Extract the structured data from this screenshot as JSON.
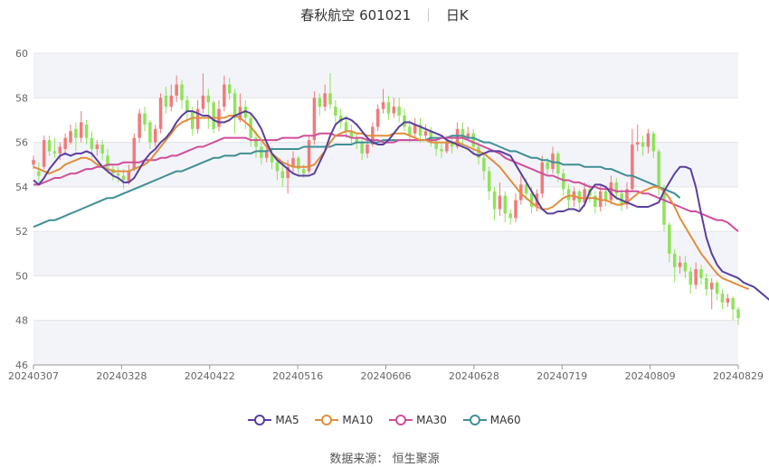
{
  "header": {
    "stock_name": "春秋航空",
    "stock_code": "601021",
    "period": "日K"
  },
  "source": {
    "label": "数据来源：",
    "provider": "恒生聚源"
  },
  "colors": {
    "up": "#f07b7b",
    "down": "#8fe35a",
    "ma5": "#5a3f9e",
    "ma10": "#e08e3c",
    "ma30": "#d04e9b",
    "ma60": "#3f8f96",
    "band": "#f3f4f9",
    "grid": "#e3e3e3"
  },
  "chart_data": {
    "type": "candlestick",
    "title": "春秋航空 601021 日K",
    "y_range": [
      46,
      60
    ],
    "y_ticks": [
      46,
      48,
      50,
      52,
      54,
      56,
      58,
      60
    ],
    "x_tick_labels": [
      "20240307",
      "20240328",
      "20240422",
      "20240516",
      "20240606",
      "20240628",
      "20240719",
      "20240809",
      "20240829"
    ],
    "legend": [
      "MA5",
      "MA10",
      "MA30",
      "MA60"
    ],
    "candles": [
      [
        55.0,
        55.2,
        55.4,
        54.8
      ],
      [
        54.7,
        54.5,
        55.1,
        54.2
      ],
      [
        54.9,
        56.1,
        56.3,
        54.8
      ],
      [
        56.1,
        55.6,
        56.3,
        55.4
      ],
      [
        55.6,
        55.5,
        56.2,
        55.3
      ],
      [
        55.5,
        55.8,
        56.0,
        55.2
      ],
      [
        55.7,
        56.2,
        56.4,
        55.5
      ],
      [
        56.0,
        56.5,
        56.8,
        55.9
      ],
      [
        56.6,
        56.2,
        56.9,
        55.6
      ],
      [
        56.2,
        56.9,
        57.4,
        56.0
      ],
      [
        56.8,
        56.2,
        57.0,
        55.9
      ],
      [
        56.2,
        55.7,
        56.5,
        55.3
      ],
      [
        55.7,
        55.9,
        56.1,
        55.4
      ],
      [
        55.9,
        55.5,
        56.1,
        55.2
      ],
      [
        55.4,
        54.9,
        55.7,
        54.6
      ],
      [
        54.8,
        54.6,
        55.0,
        54.3
      ],
      [
        54.6,
        54.5,
        54.9,
        54.2
      ],
      [
        54.5,
        54.3,
        54.8,
        53.9
      ],
      [
        54.2,
        54.7,
        55.0,
        54.1
      ],
      [
        54.8,
        56.2,
        56.4,
        54.7
      ],
      [
        56.2,
        57.3,
        57.5,
        56.0
      ],
      [
        57.3,
        56.8,
        57.6,
        56.5
      ],
      [
        56.9,
        56.0,
        57.0,
        55.7
      ],
      [
        56.0,
        56.6,
        56.8,
        55.8
      ],
      [
        56.6,
        58.0,
        58.2,
        56.4
      ],
      [
        58.1,
        57.6,
        58.5,
        57.3
      ],
      [
        57.6,
        58.1,
        58.6,
        57.4
      ],
      [
        58.1,
        58.6,
        59.0,
        57.8
      ],
      [
        58.6,
        57.9,
        58.8,
        57.5
      ],
      [
        57.9,
        57.4,
        58.1,
        56.9
      ],
      [
        57.4,
        56.6,
        57.6,
        56.3
      ],
      [
        56.6,
        57.5,
        57.9,
        56.4
      ],
      [
        57.5,
        58.1,
        59.1,
        57.3
      ],
      [
        58.1,
        57.8,
        58.4,
        56.6
      ],
      [
        57.8,
        56.6,
        57.9,
        56.4
      ],
      [
        56.7,
        57.5,
        57.9,
        56.5
      ],
      [
        57.6,
        58.6,
        59.0,
        57.4
      ],
      [
        58.6,
        58.2,
        58.9,
        57.9
      ],
      [
        58.2,
        57.1,
        58.4,
        56.4
      ],
      [
        57.0,
        57.6,
        58.2,
        56.9
      ],
      [
        57.6,
        57.1,
        57.9,
        56.6
      ],
      [
        57.1,
        56.2,
        57.3,
        55.8
      ],
      [
        56.2,
        55.8,
        56.5,
        55.3
      ],
      [
        55.8,
        55.3,
        56.0,
        55.0
      ],
      [
        55.3,
        55.6,
        55.9,
        55.1
      ],
      [
        55.5,
        55.1,
        55.8,
        54.8
      ],
      [
        55.1,
        54.7,
        55.3,
        54.3
      ],
      [
        54.7,
        54.4,
        55.0,
        54.0
      ],
      [
        54.4,
        54.9,
        55.2,
        53.7
      ],
      [
        54.9,
        55.3,
        55.6,
        54.6
      ],
      [
        55.3,
        54.8,
        55.4,
        54.5
      ],
      [
        54.8,
        54.6,
        55.0,
        54.4
      ],
      [
        54.7,
        56.1,
        56.3,
        54.6
      ],
      [
        56.1,
        58.0,
        58.3,
        55.9
      ],
      [
        58.0,
        57.6,
        58.2,
        57.2
      ],
      [
        57.6,
        58.2,
        58.6,
        57.4
      ],
      [
        58.2,
        57.7,
        59.1,
        57.5
      ],
      [
        57.6,
        57.2,
        57.9,
        56.8
      ],
      [
        57.2,
        56.9,
        57.5,
        56.6
      ],
      [
        56.9,
        56.5,
        57.2,
        56.2
      ],
      [
        56.5,
        56.2,
        56.8,
        55.9
      ],
      [
        56.2,
        56.0,
        56.4,
        55.7
      ],
      [
        56.0,
        55.5,
        56.2,
        55.2
      ],
      [
        55.5,
        55.9,
        56.1,
        55.3
      ],
      [
        55.9,
        56.7,
        56.9,
        55.8
      ],
      [
        56.7,
        57.5,
        57.7,
        56.5
      ],
      [
        57.5,
        57.8,
        58.4,
        57.3
      ],
      [
        57.8,
        57.3,
        58.1,
        57.0
      ],
      [
        57.3,
        57.6,
        58.0,
        57.1
      ],
      [
        57.6,
        57.2,
        58.0,
        56.9
      ],
      [
        57.2,
        56.7,
        57.5,
        56.5
      ],
      [
        56.7,
        56.3,
        57.0,
        56.0
      ],
      [
        56.4,
        56.8,
        57.1,
        56.2
      ],
      [
        56.8,
        56.3,
        57.1,
        56.0
      ],
      [
        56.3,
        56.5,
        56.8,
        56.1
      ],
      [
        56.5,
        56.0,
        56.7,
        55.8
      ],
      [
        56.0,
        55.7,
        56.2,
        55.4
      ],
      [
        55.7,
        55.6,
        56.0,
        55.3
      ],
      [
        55.6,
        56.0,
        56.3,
        55.5
      ],
      [
        56.0,
        55.8,
        56.3,
        55.5
      ],
      [
        55.8,
        56.6,
        56.9,
        55.7
      ],
      [
        56.6,
        56.2,
        56.9,
        55.9
      ],
      [
        56.2,
        56.4,
        56.7,
        56.1
      ],
      [
        56.4,
        55.8,
        56.6,
        55.5
      ],
      [
        55.8,
        55.3,
        56.0,
        55.0
      ],
      [
        55.3,
        54.7,
        55.5,
        54.3
      ],
      [
        54.7,
        53.8,
        54.9,
        53.4
      ],
      [
        53.8,
        53.0,
        54.0,
        52.5
      ],
      [
        53.0,
        53.6,
        54.2,
        52.7
      ],
      [
        53.6,
        52.8,
        53.8,
        52.4
      ],
      [
        52.8,
        52.6,
        53.0,
        52.3
      ],
      [
        52.6,
        53.4,
        53.7,
        52.4
      ],
      [
        53.4,
        54.1,
        54.5,
        53.2
      ],
      [
        54.1,
        53.7,
        54.4,
        53.4
      ],
      [
        53.7,
        53.1,
        54.0,
        52.8
      ],
      [
        53.1,
        53.7,
        53.9,
        52.9
      ],
      [
        53.7,
        55.1,
        55.4,
        53.5
      ],
      [
        55.1,
        54.8,
        55.3,
        54.5
      ],
      [
        54.8,
        55.5,
        55.8,
        54.6
      ],
      [
        55.5,
        54.6,
        55.6,
        54.2
      ],
      [
        54.6,
        53.9,
        54.8,
        53.6
      ],
      [
        53.9,
        53.4,
        54.1,
        53.0
      ],
      [
        53.4,
        53.8,
        54.0,
        53.1
      ],
      [
        53.8,
        53.3,
        53.9,
        53.0
      ],
      [
        53.3,
        53.9,
        54.2,
        53.1
      ],
      [
        53.9,
        53.6,
        54.1,
        53.3
      ],
      [
        53.6,
        53.1,
        53.8,
        52.8
      ],
      [
        53.1,
        53.8,
        54.1,
        52.9
      ],
      [
        53.8,
        53.4,
        54.0,
        53.1
      ],
      [
        53.4,
        54.2,
        54.5,
        53.2
      ],
      [
        54.2,
        53.7,
        54.4,
        53.4
      ],
      [
        53.7,
        53.2,
        53.9,
        52.9
      ],
      [
        53.2,
        53.9,
        54.2,
        53.0
      ],
      [
        53.9,
        55.9,
        56.6,
        53.8
      ],
      [
        55.9,
        56.0,
        56.8,
        55.6
      ],
      [
        56.0,
        55.8,
        56.3,
        55.4
      ],
      [
        55.8,
        56.4,
        56.6,
        55.5
      ],
      [
        56.4,
        55.6,
        56.5,
        55.3
      ],
      [
        55.6,
        53.9,
        55.7,
        53.6
      ],
      [
        53.9,
        52.3,
        54.1,
        52.0
      ],
      [
        52.3,
        51.0,
        52.4,
        50.6
      ],
      [
        51.0,
        50.4,
        51.2,
        49.7
      ],
      [
        50.4,
        50.6,
        50.9,
        50.1
      ],
      [
        50.6,
        50.2,
        50.9,
        49.9
      ],
      [
        50.2,
        49.6,
        50.4,
        49.2
      ],
      [
        49.6,
        50.3,
        50.6,
        49.4
      ],
      [
        50.3,
        49.9,
        50.5,
        49.6
      ],
      [
        49.9,
        49.4,
        50.1,
        49.1
      ],
      [
        49.4,
        49.7,
        49.9,
        48.5
      ],
      [
        49.7,
        49.2,
        49.8,
        48.9
      ],
      [
        49.2,
        48.8,
        49.4,
        48.5
      ],
      [
        48.8,
        49.0,
        49.2,
        48.6
      ],
      [
        49.0,
        48.5,
        49.1,
        48.0
      ],
      [
        48.5,
        48.1,
        48.6,
        47.8
      ]
    ],
    "ma5": [
      54.3,
      54.1,
      54.4,
      54.8,
      55.1,
      55.4,
      55.5,
      55.4,
      55.5,
      55.5,
      55.6,
      55.5,
      55.2,
      54.9,
      54.7,
      54.5,
      54.4,
      54.2,
      54.2,
      54.4,
      54.8,
      55.2,
      55.5,
      55.7,
      56.0,
      56.2,
      56.5,
      56.9,
      57.2,
      57.4,
      57.4,
      57.3,
      57.2,
      57.2,
      57.0,
      56.9,
      56.9,
      57.0,
      57.2,
      57.3,
      57.4,
      57.3,
      57.0,
      56.6,
      56.0,
      55.5,
      55.2,
      55.0,
      54.8,
      54.6,
      54.5,
      54.5,
      54.5,
      54.6,
      55.1,
      55.6,
      56.3,
      56.8,
      57.0,
      57.1,
      57.0,
      56.8,
      56.5,
      56.2,
      56.0,
      55.9,
      55.9,
      56.1,
      56.4,
      56.7,
      56.9,
      56.9,
      56.8,
      56.7,
      56.6,
      56.5,
      56.4,
      56.3,
      56.1,
      56.0,
      55.9,
      55.8,
      55.7,
      55.5,
      55.4,
      55.5,
      55.6,
      55.6,
      55.6,
      55.5,
      55.4,
      55.0,
      54.6,
      54.2,
      53.8,
      53.4,
      53.0,
      52.8,
      52.8,
      52.9,
      52.9,
      53.0,
      53.0,
      52.9,
      53.2,
      53.8,
      54.1,
      54.1,
      54.0,
      53.7,
      53.5,
      53.4,
      53.3,
      53.2,
      53.1,
      53.1,
      53.1,
      53.2,
      53.3,
      53.8,
      54.2,
      54.6,
      54.9,
      54.9,
      54.8,
      54.0,
      52.8,
      51.7,
      51.0,
      50.5,
      50.2,
      50.1,
      50.0,
      49.9,
      49.7,
      49.6,
      49.5,
      49.3,
      49.1,
      48.9
    ],
    "ma10": [
      54.9,
      54.8,
      54.7,
      54.6,
      54.7,
      54.8,
      55.0,
      55.1,
      55.2,
      55.3,
      55.3,
      55.2,
      55.0,
      54.9,
      54.8,
      54.7,
      54.7,
      54.7,
      54.7,
      54.8,
      54.9,
      55.0,
      55.2,
      55.5,
      55.8,
      56.1,
      56.4,
      56.7,
      56.9,
      57.0,
      57.1,
      57.1,
      57.1,
      57.1,
      57.1,
      57.1,
      57.1,
      57.2,
      57.2,
      57.1,
      56.9,
      56.7,
      56.4,
      56.1,
      55.8,
      55.5,
      55.3,
      55.1,
      55.0,
      54.9,
      54.9,
      54.9,
      54.9,
      55.0,
      55.3,
      55.6,
      56.0,
      56.3,
      56.4,
      56.5,
      56.5,
      56.4,
      56.4,
      56.3,
      56.3,
      56.3,
      56.3,
      56.3,
      56.4,
      56.4,
      56.4,
      56.3,
      56.2,
      56.1,
      56.1,
      56.0,
      56.0,
      56.0,
      56.0,
      56.0,
      56.0,
      55.9,
      55.8,
      55.7,
      55.6,
      55.5,
      55.3,
      55.1,
      54.9,
      54.6,
      54.3,
      54.0,
      53.7,
      53.5,
      53.3,
      53.1,
      53.0,
      53.0,
      53.1,
      53.3,
      53.5,
      53.6,
      53.6,
      53.5,
      53.5,
      53.5,
      53.5,
      53.4,
      53.4,
      53.3,
      53.2,
      53.2,
      53.3,
      53.5,
      53.7,
      53.8,
      53.9,
      54.0,
      54.0,
      53.8,
      53.5,
      53.1,
      52.6,
      52.2,
      51.8,
      51.4,
      51.0,
      50.7,
      50.4,
      50.1,
      49.9,
      49.8,
      49.7,
      49.6,
      49.5,
      49.4
    ],
    "ma30": [
      54.1,
      54.1,
      54.2,
      54.3,
      54.4,
      54.4,
      54.5,
      54.6,
      54.6,
      54.7,
      54.8,
      54.8,
      54.9,
      54.9,
      55.0,
      55.0,
      55.0,
      55.1,
      55.1,
      55.1,
      55.1,
      55.2,
      55.2,
      55.2,
      55.3,
      55.3,
      55.4,
      55.4,
      55.5,
      55.6,
      55.7,
      55.8,
      55.8,
      55.9,
      56.0,
      56.1,
      56.2,
      56.2,
      56.2,
      56.2,
      56.2,
      56.1,
      56.1,
      56.1,
      56.1,
      56.1,
      56.1,
      56.2,
      56.2,
      56.2,
      56.2,
      56.3,
      56.3,
      56.3,
      56.4,
      56.4,
      56.4,
      56.3,
      56.3,
      56.3,
      56.2,
      56.2,
      56.2,
      56.1,
      56.1,
      56.1,
      56.0,
      56.0,
      56.0,
      56.1,
      56.1,
      56.1,
      56.1,
      56.1,
      56.1,
      56.1,
      56.1,
      56.2,
      56.2,
      56.2,
      56.2,
      56.2,
      56.1,
      56.0,
      55.9,
      55.8,
      55.7,
      55.6,
      55.5,
      55.3,
      55.2,
      55.1,
      55.0,
      54.9,
      54.8,
      54.7,
      54.6,
      54.5,
      54.5,
      54.4,
      54.3,
      54.3,
      54.2,
      54.2,
      54.1,
      54.0,
      54.0,
      53.9,
      53.9,
      53.9,
      53.8,
      53.8,
      53.8,
      53.8,
      53.8,
      53.7,
      53.7,
      53.6,
      53.5,
      53.4,
      53.3,
      53.2,
      53.1,
      53.0,
      52.9,
      52.9,
      52.8,
      52.7,
      52.6,
      52.5,
      52.5,
      52.4,
      52.2,
      52.0
    ],
    "ma60": [
      52.2,
      52.3,
      52.4,
      52.5,
      52.5,
      52.6,
      52.7,
      52.8,
      52.9,
      53.0,
      53.1,
      53.2,
      53.3,
      53.4,
      53.5,
      53.5,
      53.6,
      53.7,
      53.8,
      53.9,
      54.0,
      54.1,
      54.2,
      54.3,
      54.4,
      54.5,
      54.6,
      54.7,
      54.7,
      54.8,
      54.9,
      55.0,
      55.1,
      55.2,
      55.3,
      55.3,
      55.4,
      55.4,
      55.4,
      55.5,
      55.5,
      55.5,
      55.6,
      55.6,
      55.6,
      55.7,
      55.7,
      55.7,
      55.7,
      55.7,
      55.7,
      55.8,
      55.8,
      55.8,
      55.8,
      55.8,
      55.8,
      55.9,
      55.9,
      55.9,
      55.9,
      56.0,
      56.0,
      56.0,
      56.0,
      56.0,
      56.1,
      56.1,
      56.1,
      56.1,
      56.1,
      56.1,
      56.1,
      56.1,
      56.1,
      56.2,
      56.2,
      56.2,
      56.2,
      56.3,
      56.3,
      56.3,
      56.2,
      56.2,
      56.1,
      56.0,
      56.0,
      55.9,
      55.8,
      55.7,
      55.6,
      55.6,
      55.5,
      55.4,
      55.3,
      55.3,
      55.2,
      55.2,
      55.1,
      55.1,
      55.0,
      55.0,
      55.0,
      55.0,
      54.9,
      54.9,
      54.9,
      54.9,
      54.8,
      54.8,
      54.7,
      54.6,
      54.5,
      54.5,
      54.4,
      54.3,
      54.2,
      54.1,
      54.0,
      53.9,
      53.8,
      53.7,
      53.5
    ]
  }
}
